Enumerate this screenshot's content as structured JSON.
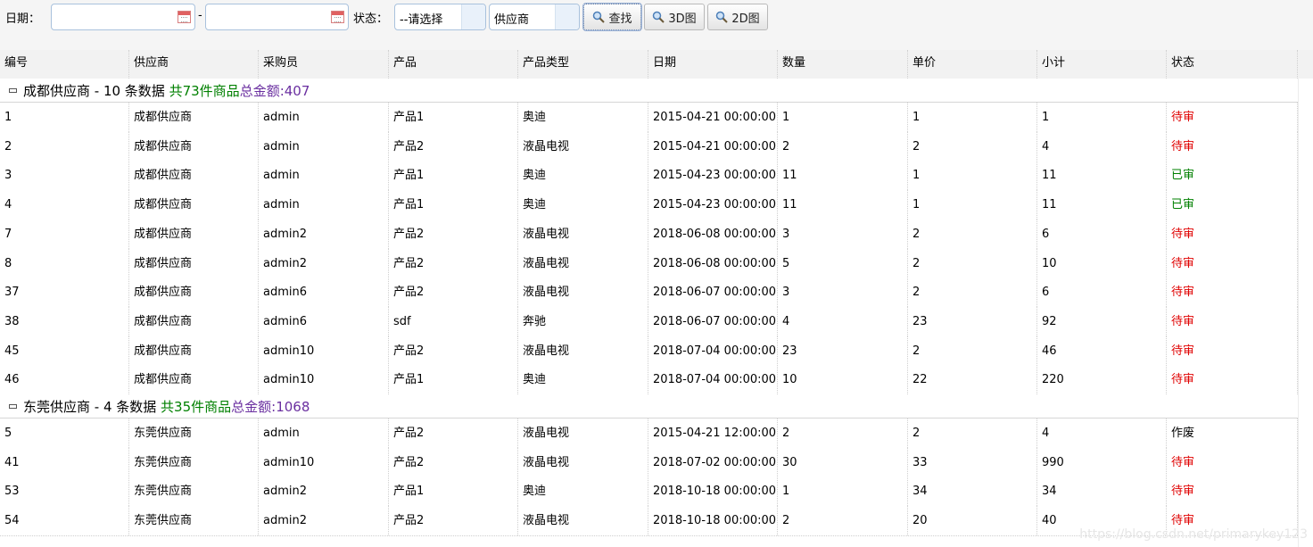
{
  "toolbar": {
    "date_label": "日期：",
    "date_start": "",
    "date_sep": "-",
    "date_end": "",
    "status_label": "状态：",
    "status_select": "--请选择",
    "group_select": "供应商",
    "search_button": "查找",
    "button_3d": "3D图",
    "button_2d": "2D图"
  },
  "columns": [
    "编号",
    "供应商",
    "采购员",
    "产品",
    "产品类型",
    "日期",
    "数量",
    "单价",
    "小计",
    "状态"
  ],
  "groups": [
    {
      "name": "成都供应商 - 10 条数据",
      "count": "共73件商品",
      "sum": "总金额:407",
      "rows": [
        {
          "id": "1",
          "supplier": "成都供应商",
          "buyer": "admin",
          "product": "产品1",
          "type": "奥迪",
          "date": "2015-04-21 00:00:00",
          "qty": "1",
          "price": "1",
          "subtotal": "1",
          "status": "待审",
          "status_kind": "pending"
        },
        {
          "id": "2",
          "supplier": "成都供应商",
          "buyer": "admin",
          "product": "产品2",
          "type": "液晶电视",
          "date": "2015-04-21 00:00:00",
          "qty": "2",
          "price": "2",
          "subtotal": "4",
          "status": "待审",
          "status_kind": "pending"
        },
        {
          "id": "3",
          "supplier": "成都供应商",
          "buyer": "admin",
          "product": "产品1",
          "type": "奥迪",
          "date": "2015-04-23 00:00:00",
          "qty": "11",
          "price": "1",
          "subtotal": "11",
          "status": "已审",
          "status_kind": "approved"
        },
        {
          "id": "4",
          "supplier": "成都供应商",
          "buyer": "admin",
          "product": "产品1",
          "type": "奥迪",
          "date": "2015-04-23 00:00:00",
          "qty": "11",
          "price": "1",
          "subtotal": "11",
          "status": "已审",
          "status_kind": "approved"
        },
        {
          "id": "7",
          "supplier": "成都供应商",
          "buyer": "admin2",
          "product": "产品2",
          "type": "液晶电视",
          "date": "2018-06-08 00:00:00",
          "qty": "3",
          "price": "2",
          "subtotal": "6",
          "status": "待审",
          "status_kind": "pending"
        },
        {
          "id": "8",
          "supplier": "成都供应商",
          "buyer": "admin2",
          "product": "产品2",
          "type": "液晶电视",
          "date": "2018-06-08 00:00:00",
          "qty": "5",
          "price": "2",
          "subtotal": "10",
          "status": "待审",
          "status_kind": "pending"
        },
        {
          "id": "37",
          "supplier": "成都供应商",
          "buyer": "admin6",
          "product": "产品2",
          "type": "液晶电视",
          "date": "2018-06-07 00:00:00",
          "qty": "3",
          "price": "2",
          "subtotal": "6",
          "status": "待审",
          "status_kind": "pending"
        },
        {
          "id": "38",
          "supplier": "成都供应商",
          "buyer": "admin6",
          "product": "sdf",
          "type": "奔驰",
          "date": "2018-06-07 00:00:00",
          "qty": "4",
          "price": "23",
          "subtotal": "92",
          "status": "待审",
          "status_kind": "pending"
        },
        {
          "id": "45",
          "supplier": "成都供应商",
          "buyer": "admin10",
          "product": "产品2",
          "type": "液晶电视",
          "date": "2018-07-04 00:00:00",
          "qty": "23",
          "price": "2",
          "subtotal": "46",
          "status": "待审",
          "status_kind": "pending"
        },
        {
          "id": "46",
          "supplier": "成都供应商",
          "buyer": "admin10",
          "product": "产品1",
          "type": "奥迪",
          "date": "2018-07-04 00:00:00",
          "qty": "10",
          "price": "22",
          "subtotal": "220",
          "status": "待审",
          "status_kind": "pending"
        }
      ]
    },
    {
      "name": "东莞供应商 - 4 条数据",
      "count": "共35件商品",
      "sum": "总金额:1068",
      "rows": [
        {
          "id": "5",
          "supplier": "东莞供应商",
          "buyer": "admin",
          "product": "产品2",
          "type": "液晶电视",
          "date": "2015-04-21 12:00:00",
          "qty": "2",
          "price": "2",
          "subtotal": "4",
          "status": "作废",
          "status_kind": "void"
        },
        {
          "id": "41",
          "supplier": "东莞供应商",
          "buyer": "admin10",
          "product": "产品2",
          "type": "液晶电视",
          "date": "2018-07-02 00:00:00",
          "qty": "30",
          "price": "33",
          "subtotal": "990",
          "status": "待审",
          "status_kind": "pending"
        },
        {
          "id": "53",
          "supplier": "东莞供应商",
          "buyer": "admin2",
          "product": "产品1",
          "type": "奥迪",
          "date": "2018-10-18 00:00:00",
          "qty": "1",
          "price": "34",
          "subtotal": "34",
          "status": "待审",
          "status_kind": "pending"
        },
        {
          "id": "54",
          "supplier": "东莞供应商",
          "buyer": "admin2",
          "product": "产品2",
          "type": "液晶电视",
          "date": "2018-10-18 00:00:00",
          "qty": "2",
          "price": "20",
          "subtotal": "40",
          "status": "待审",
          "status_kind": "pending"
        }
      ]
    }
  ],
  "watermark": "https://blog.csdn.net/primarykey123",
  "colors": {
    "pending": "#e00000",
    "approved": "#008000",
    "void": "#000000",
    "group_count": "#008000",
    "group_sum": "#6a2fa0"
  }
}
